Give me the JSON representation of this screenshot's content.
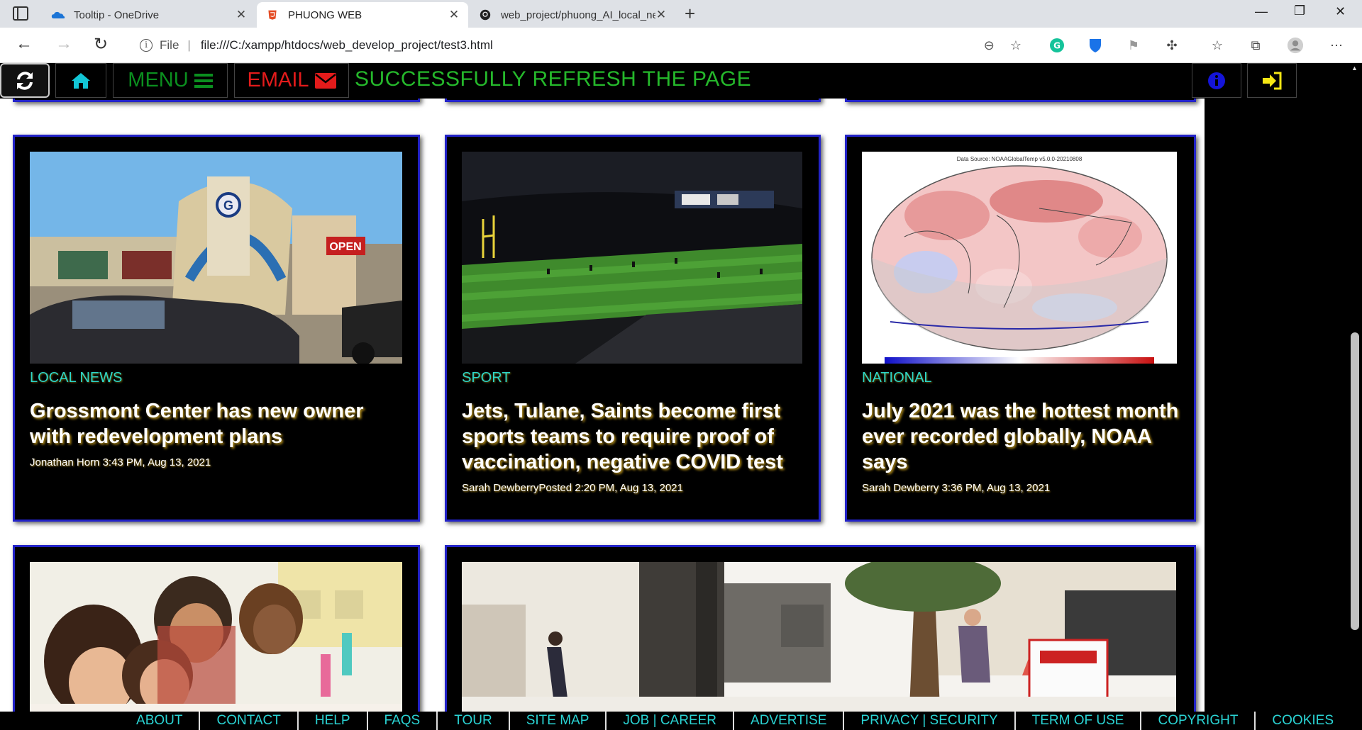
{
  "browser": {
    "tabs": [
      {
        "title": "Tooltip - OneDrive",
        "icon": "onedrive-icon"
      },
      {
        "title": "PHUONG WEB",
        "icon": "html5-icon"
      },
      {
        "title": "web_project/phuong_AI_local_ne",
        "icon": "github-icon"
      }
    ],
    "url_scheme": "File",
    "url": "file:///C:/xampp/htdocs/web_develop_project/test3.html"
  },
  "appbar": {
    "menu_label": "MENU",
    "email_label": "EMAIL",
    "status": "SUCCESSFULLY REFRESH THE PAGE"
  },
  "cards": [
    {
      "category": "LOCAL NEWS",
      "headline": "Grossmont Center has new owner with redevelopment plans",
      "byline": "Jonathan Horn 3:43 PM, Aug 13, 2021",
      "sign_text": "OPEN"
    },
    {
      "category": "SPORT",
      "headline": "Jets, Tulane, Saints become first sports teams to require proof of vaccination, negative COVID test",
      "byline": "Sarah DewberryPosted 2:20 PM, Aug 13, 2021"
    },
    {
      "category": "NATIONAL",
      "headline": "July 2021 was the hottest month ever recorded globally, NOAA says",
      "byline": "Sarah Dewberry 3:36 PM, Aug 13, 2021",
      "map_caption": "Data Source: NOAAGlobalTemp v5.0.0-20210808"
    }
  ],
  "footer": {
    "links": [
      "ABOUT",
      "CONTACT",
      "HELP",
      "FAQS",
      "TOUR",
      "SITE MAP",
      "JOB | CAREER",
      "ADVERTISE",
      "PRIVACY | SECURITY",
      "TERM OF USE",
      "COPYRIGHT",
      "COOKIES"
    ]
  },
  "colors": {
    "accent_blue": "#2323c8",
    "category_cyan": "#2dd6c9",
    "status_green": "#25b82b",
    "menu_green": "#0b8f1f",
    "email_red": "#e31b1b",
    "login_yellow": "#f5e614"
  }
}
